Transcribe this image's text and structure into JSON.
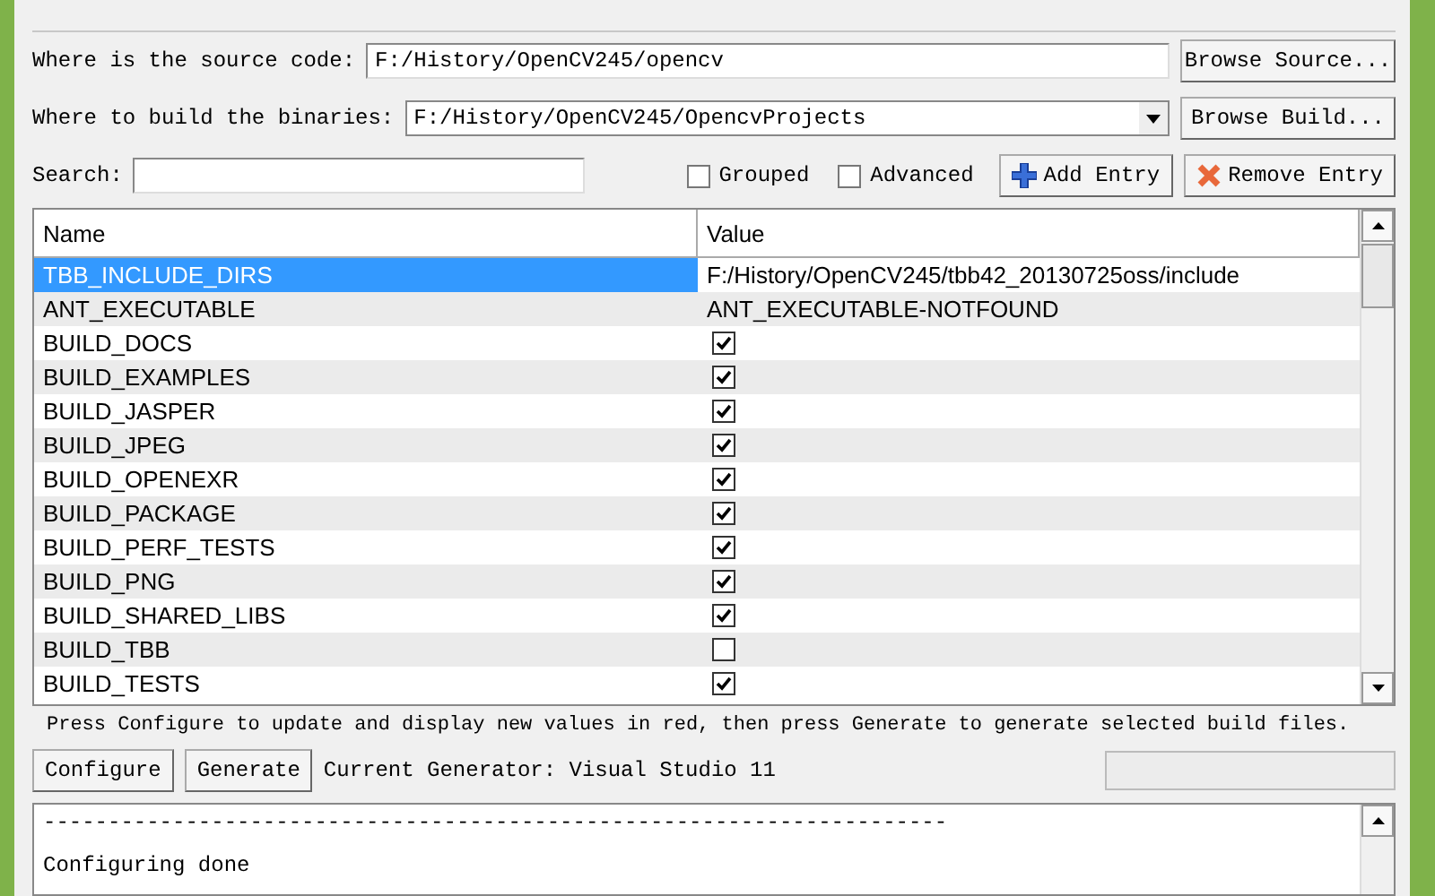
{
  "source": {
    "label": "Where is the source code:",
    "value": "F:/History/OpenCV245/opencv",
    "button": "Browse Source..."
  },
  "build": {
    "label": "Where to build the binaries:",
    "value": "F:/History/OpenCV245/OpencvProjects",
    "button": "Browse Build..."
  },
  "search": {
    "label": "Search:"
  },
  "options": [
    {
      "label": "Grouped",
      "checked": false
    },
    {
      "label": "Advanced",
      "checked": false
    }
  ],
  "add_button": "Add Entry",
  "remove_button": "Remove Entry",
  "table": {
    "columns": [
      "Name",
      "Value"
    ],
    "rows": [
      {
        "name": "TBB_INCLUDE_DIRS",
        "kind": "text",
        "value": "F:/History/OpenCV245/tbb42_20130725oss/include",
        "selected": true
      },
      {
        "name": "ANT_EXECUTABLE",
        "kind": "text",
        "value": "ANT_EXECUTABLE-NOTFOUND",
        "selected": false
      },
      {
        "name": "BUILD_DOCS",
        "kind": "checkbox",
        "checked": true,
        "selected": false
      },
      {
        "name": "BUILD_EXAMPLES",
        "kind": "checkbox",
        "checked": true,
        "selected": false
      },
      {
        "name": "BUILD_JASPER",
        "kind": "checkbox",
        "checked": true,
        "selected": false
      },
      {
        "name": "BUILD_JPEG",
        "kind": "checkbox",
        "checked": true,
        "selected": false
      },
      {
        "name": "BUILD_OPENEXR",
        "kind": "checkbox",
        "checked": true,
        "selected": false
      },
      {
        "name": "BUILD_PACKAGE",
        "kind": "checkbox",
        "checked": true,
        "selected": false
      },
      {
        "name": "BUILD_PERF_TESTS",
        "kind": "checkbox",
        "checked": true,
        "selected": false
      },
      {
        "name": "BUILD_PNG",
        "kind": "checkbox",
        "checked": true,
        "selected": false
      },
      {
        "name": "BUILD_SHARED_LIBS",
        "kind": "checkbox",
        "checked": true,
        "selected": false
      },
      {
        "name": "BUILD_TBB",
        "kind": "checkbox",
        "checked": false,
        "selected": false
      },
      {
        "name": "BUILD_TESTS",
        "kind": "checkbox",
        "checked": true,
        "selected": false
      }
    ]
  },
  "hint": "Press Configure to update and display new values in red, then press Generate to generate selected build files.",
  "configure_button": "Configure",
  "generate_button": "Generate",
  "generator": "Current Generator: Visual Studio 11",
  "output": [
    "----------------------------------------------------------------------",
    "Configuring done"
  ]
}
